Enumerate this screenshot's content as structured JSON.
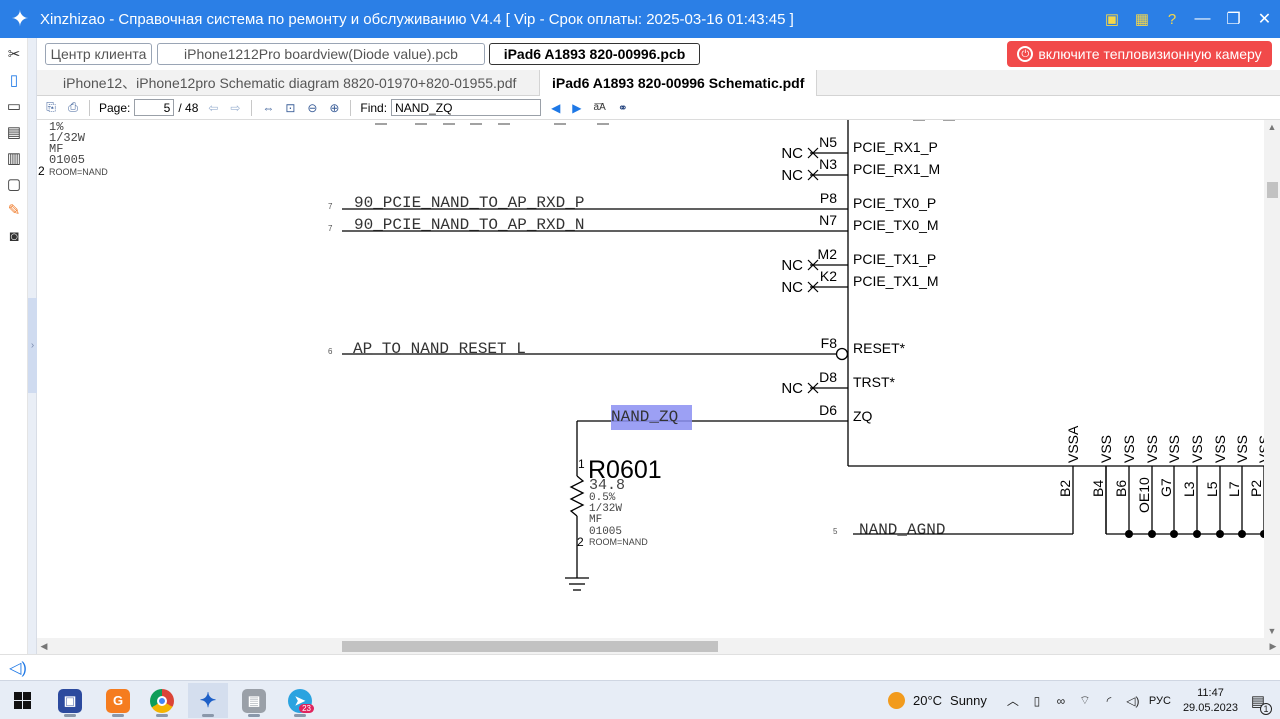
{
  "titlebar": {
    "title": "Xinzhizao - Справочная система по ремонту и обслуживанию V4.4 [ Vip - Срок оплаты: 2025-03-16 01:43:45 ]"
  },
  "tabs_top": [
    {
      "label": "Центр клиента"
    },
    {
      "label": "iPhone1212Pro boardview(Diode value).pcb"
    },
    {
      "label": "iPad6 A1893 820-00996.pcb"
    }
  ],
  "thermal_button": {
    "label": "включите тепловизионную камеру"
  },
  "tabs_docs": [
    {
      "label": "iPhone12、iPhone12pro Schematic diagram 8820-01970+820-01955.pdf"
    },
    {
      "label": "iPad6 A1893 820-00996 Schematic.pdf"
    }
  ],
  "toolbar": {
    "page_label": "Page:",
    "page_value": "5",
    "page_total": "/ 48",
    "find_label": "Find:",
    "find_value": "NAND_ZQ"
  },
  "schematic": {
    "left_component": {
      "lines": [
        "1%",
        "1/32W",
        "MF",
        "01005"
      ],
      "pin": "2",
      "room": "ROOM=NAND"
    },
    "nets": {
      "rxd_p": {
        "sheet": "7",
        "name": "90_PCIE_NAND_TO_AP_RXD_P"
      },
      "rxd_n": {
        "sheet": "7",
        "name": "90_PCIE_NAND_TO_AP_RXD_N"
      },
      "reset": {
        "sheet": "6",
        "name": "AP_TO_NAND_RESET_L"
      },
      "zq": {
        "name": "NAND_ZQ"
      },
      "agnd": {
        "sheet": "5",
        "name": "NAND_AGND"
      }
    },
    "nc_label": "NC",
    "pins": [
      {
        "num": "N5",
        "name": "PCIE_RX1_P"
      },
      {
        "num": "N3",
        "name": "PCIE_RX1_M"
      },
      {
        "num": "P8",
        "name": "PCIE_TX0_P"
      },
      {
        "num": "N7",
        "name": "PCIE_TX0_M"
      },
      {
        "num": "M2",
        "name": "PCIE_TX1_P"
      },
      {
        "num": "K2",
        "name": "PCIE_TX1_M"
      },
      {
        "num": "F8",
        "name": "RESET*"
      },
      {
        "num": "D8",
        "name": "TRST*"
      },
      {
        "num": "D6",
        "name": "ZQ"
      }
    ],
    "bottom_pins": [
      {
        "name": "VSSA",
        "num": "B2"
      },
      {
        "name": "VSS",
        "num": "B4"
      },
      {
        "name": "VSS",
        "num": "B6"
      },
      {
        "name": "VSS",
        "num": "OE10"
      },
      {
        "name": "VSS",
        "num": "G7"
      },
      {
        "name": "VSS",
        "num": "L3"
      },
      {
        "name": "VSS",
        "num": "L5"
      },
      {
        "name": "VSS",
        "num": "L7"
      },
      {
        "name": "VSS",
        "num": "P2"
      }
    ],
    "resistor": {
      "ref": "R0601",
      "pin1": "1",
      "value": "34.8",
      "tolerance": "0.5%",
      "power": "1/32W",
      "type": "MF",
      "package": "01005",
      "pin2": "2",
      "room": "ROOM=NAND"
    }
  },
  "taskbar": {
    "weather_temp": "20°C",
    "weather_text": "Sunny",
    "language": "РУС",
    "time": "11:47",
    "date": "29.05.2023",
    "telegram_badge": "23",
    "notifications": "1"
  }
}
